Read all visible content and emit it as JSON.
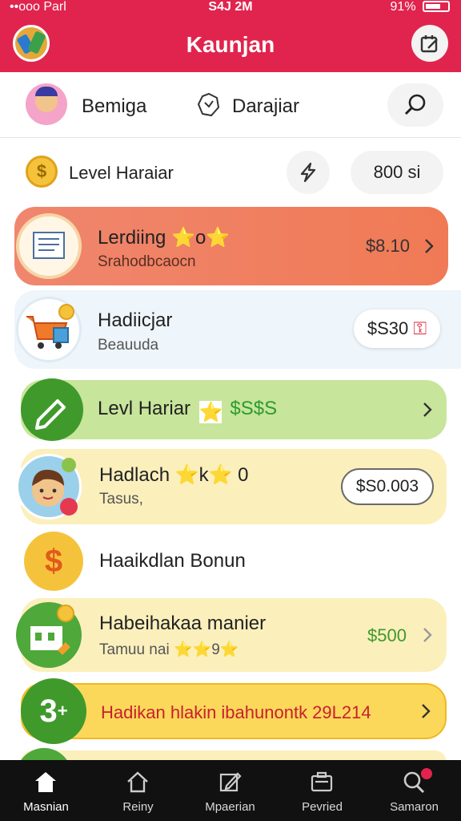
{
  "status_bar": {
    "carrier": "••ooo Parl",
    "time": "S4J 2M",
    "battery": "91%"
  },
  "app_bar": {
    "title": "Kaunjan"
  },
  "header_row": {
    "tab_a_label": "Bemiga",
    "tab_b_label": "Darajiar"
  },
  "level_row": {
    "label": "Level Haraiar",
    "value": "800 si"
  },
  "cards": [
    {
      "title": "Lerdiing ⭐o⭐",
      "subtitle": "Srahodbcaocn",
      "amount": "$8.10"
    },
    {
      "title": "Hadiicjar",
      "subtitle": "Beauuda",
      "amount": "$S30"
    },
    {
      "title": "Levl Hariar",
      "suffix": "$S$S"
    },
    {
      "title": "Hadlach ⭐k⭐ 0",
      "subtitle": "Tasus,",
      "amount": "$S0.003"
    },
    {
      "title": "Haaikdlan Bonun"
    },
    {
      "title": "Habeihakaa manier",
      "subtitle": "Tamuu nai ⭐⭐9⭐",
      "amount": "$500"
    },
    {
      "title": "Hadikan hlakin ibahunontk 29L214"
    }
  ],
  "tab_bar": {
    "items": [
      {
        "label": "Masnian",
        "icon": "home-icon"
      },
      {
        "label": "Reiny",
        "icon": "house-outline-icon"
      },
      {
        "label": "Mpaerian",
        "icon": "edit-icon"
      },
      {
        "label": "Pevried",
        "icon": "briefcase-icon"
      },
      {
        "label": "Samaron",
        "icon": "search-icon"
      }
    ]
  },
  "colors": {
    "brand": "#e0244e",
    "green": "#3f9a2b",
    "gold": "#f5c33b"
  }
}
